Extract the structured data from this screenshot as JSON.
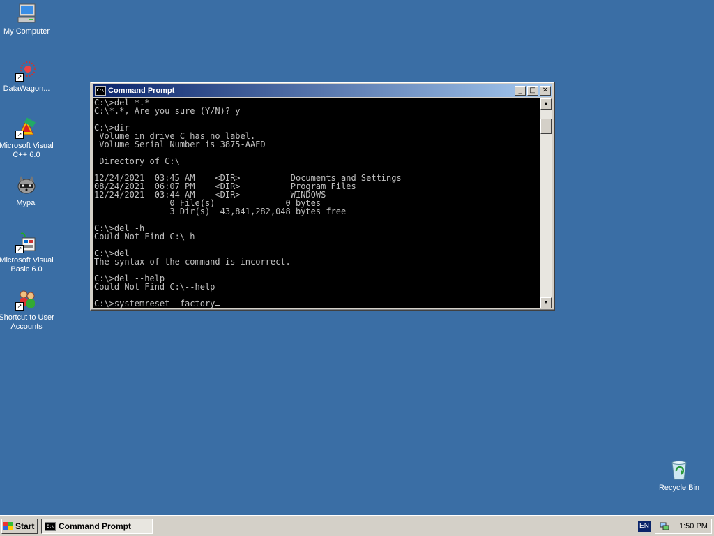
{
  "desktop": {
    "icons": [
      {
        "label": "My Computer"
      },
      {
        "label": "DataWagon..."
      },
      {
        "label": "Microsoft Visual C++ 6.0"
      },
      {
        "label": "Mypal"
      },
      {
        "label": "Microsoft Visual Basic 6.0"
      },
      {
        "label": "Shortcut to User Accounts"
      },
      {
        "label": "Recycle Bin"
      }
    ]
  },
  "window": {
    "title": "Command Prompt",
    "icon_text": "C:\\",
    "minimize_glyph": "_",
    "maximize_glyph": "□",
    "close_glyph": "✕",
    "console_lines": [
      "C:\\>del *.*",
      "C:\\*.*, Are you sure (Y/N)? y",
      "",
      "C:\\>dir",
      " Volume in drive C has no label.",
      " Volume Serial Number is 3875-AAED",
      "",
      " Directory of C:\\",
      "",
      "12/24/2021  03:45 AM    <DIR>          Documents and Settings",
      "08/24/2021  06:07 PM    <DIR>          Program Files",
      "12/24/2021  03:44 AM    <DIR>          WINDOWS",
      "               0 File(s)              0 bytes",
      "               3 Dir(s)  43,841,282,048 bytes free",
      "",
      "C:\\>del -h",
      "Could Not Find C:\\-h",
      "",
      "C:\\>del",
      "The syntax of the command is incorrect.",
      "",
      "C:\\>del --help",
      "Could Not Find C:\\--help",
      ""
    ],
    "current_input": "C:\\>systemreset -factory",
    "scroll_up_glyph": "▲",
    "scroll_down_glyph": "▼"
  },
  "taskbar": {
    "start_label": "Start",
    "task_label": "Command Prompt",
    "language": "EN",
    "clock": "1:50 PM"
  },
  "colors": {
    "desktop_bg": "#3a6ea5",
    "titlebar_start": "#0a246a",
    "titlebar_end": "#a6caf0",
    "console_bg": "#000000",
    "console_text": "#c0c0c0"
  }
}
